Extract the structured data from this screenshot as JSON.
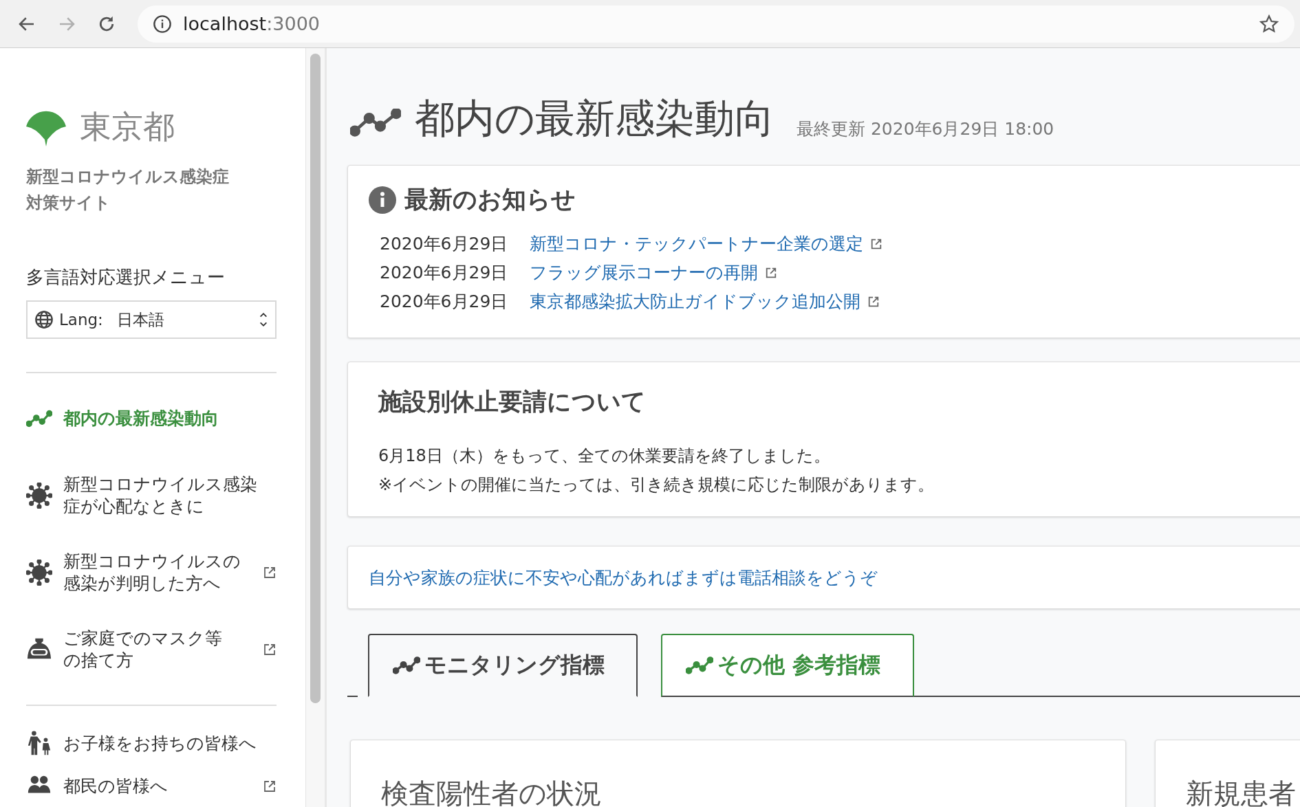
{
  "browser": {
    "host": "localhost",
    "port": ":3000",
    "forward_disabled": true
  },
  "sidebar": {
    "logo_text": "東京都",
    "site_title": [
      "新型コロナウイルス感染症",
      "対策サイト"
    ],
    "language_menu": {
      "label": "多言語対応選択メニュー",
      "prefix": "Lang:",
      "value": "日本語"
    },
    "nav_groups": [
      [
        {
          "kind": "trend",
          "label": [
            "都内の最新感染動向"
          ],
          "external": false,
          "selected": true
        },
        {
          "kind": "virus",
          "label": [
            "新型コロナウイルス感染",
            "症が心配なときに"
          ],
          "external": false,
          "selected": false
        },
        {
          "kind": "virus",
          "label": [
            "新型コロナウイルスの",
            "感染が判明した方へ"
          ],
          "external": true,
          "selected": false
        },
        {
          "kind": "bag",
          "label": [
            "ご家庭でのマスク等",
            "の捨て方"
          ],
          "external": true,
          "selected": false
        }
      ],
      [
        {
          "kind": "family",
          "label": [
            "お子様をお持ちの皆様へ"
          ],
          "external": false,
          "selected": false
        },
        {
          "kind": "people",
          "label": [
            "都民の皆様へ"
          ],
          "external": true,
          "selected": false
        }
      ]
    ]
  },
  "main": {
    "heading": "都内の最新感染動向",
    "updated": "最終更新 2020年6月29日 18:00",
    "news": {
      "title": "最新のお知らせ",
      "items": [
        {
          "date": "2020年6月29日",
          "title": "新型コロナ・テックパートナー企業の選定"
        },
        {
          "date": "2020年6月29日",
          "title": "フラッグ展示コーナーの再開"
        },
        {
          "date": "2020年6月29日",
          "title": "東京都感染拡大防止ガイドブック追加公開"
        }
      ]
    },
    "notice": {
      "title": "施設別休止要請について",
      "lines": [
        "6月18日（木）をもって、全ての休業要請を終了しました。",
        "※イベントの開催に当たっては、引き続き規模に応じた制限があります。"
      ]
    },
    "consult_link": "自分や家族の症状に不安や心配があればまずは電話相談をどうぞ",
    "tabs": [
      {
        "label": "モニタリング指標",
        "selected": true
      },
      {
        "label": "その他 参考指標",
        "selected": false
      }
    ],
    "cards": [
      {
        "title": "検査陽性者の状況"
      },
      {
        "title": "新規患者"
      }
    ]
  }
}
